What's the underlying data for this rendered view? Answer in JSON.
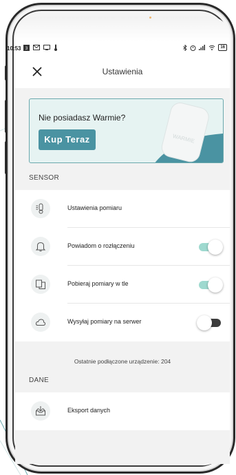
{
  "status_bar": {
    "time": "10:53",
    "battery": "16"
  },
  "header": {
    "title": "Ustawienia"
  },
  "promo": {
    "title": "Nie posiadasz Warmie?",
    "button_label": "Kup Teraz",
    "device_logo": "WARMIE"
  },
  "sensor_section": {
    "title": "SENSOR",
    "items": [
      {
        "label": "Ustawienia pomiaru",
        "icon": "thermometer-icon"
      },
      {
        "label": "Powiadom o rozłączeniu",
        "icon": "bell-icon",
        "toggle": true
      },
      {
        "label": "Pobieraj pomiary w tle",
        "icon": "background-sync-icon",
        "toggle": true
      },
      {
        "label": "Wysyłaj pomiary na serwer",
        "icon": "cloud-icon",
        "toggle": false
      }
    ],
    "last_device_note": "Ostatnie podłączone urządzenie: 204"
  },
  "data_section": {
    "title": "DANE",
    "items": [
      {
        "label": "Eksport danych",
        "icon": "export-icon"
      }
    ]
  },
  "colors": {
    "accent": "#4a93a2",
    "toggle_on": "#9ed9cf",
    "banner_bg": "#e6f3f2",
    "banner_border": "#6aa8ad"
  }
}
